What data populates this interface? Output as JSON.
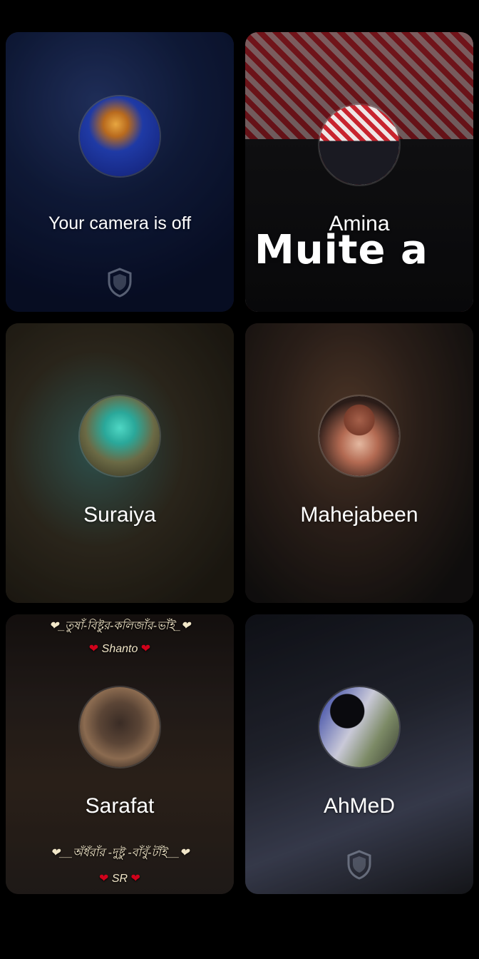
{
  "call": {
    "self_tile": {
      "status": "Your camera is off"
    },
    "participants": [
      {
        "name": "Amina"
      },
      {
        "name": "Suraiya"
      },
      {
        "name": "Mahejabeen"
      },
      {
        "name": "Sarafat"
      },
      {
        "name": "AhMeD"
      }
    ]
  },
  "overlay": {
    "text": "Muite a"
  },
  "sarafat_tile": {
    "banner_top": "❤_তুষাঁ-বিষ্টুর-কলিজাঁর-ভাঁই_❤",
    "banner_top_name": "Shanto",
    "banner_bottom": "❤__অঁধঁরাঁর -দুষ্টু -বাঁবুঁ-টাঁই__❤",
    "banner_bottom_name": "SR"
  },
  "colors": {
    "background": "#000000",
    "text": "#ffffff",
    "accent_heart": "#d0021b"
  }
}
